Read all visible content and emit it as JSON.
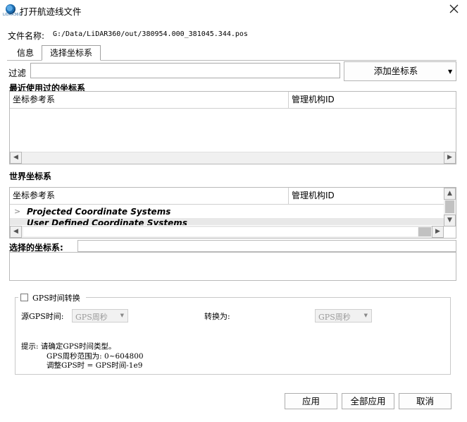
{
  "window": {
    "title": "打开航迹线文件",
    "logo_text": "LIDAR360"
  },
  "file": {
    "label": "文件名称:",
    "path": "G:/Data/LiDAR360/out/380954.000_381045.344.pos"
  },
  "tabs": [
    {
      "label": "信息",
      "active": false
    },
    {
      "label": "选择坐标系",
      "active": true
    }
  ],
  "filter": {
    "label": "过滤",
    "value": "",
    "add_button": "添加坐标系"
  },
  "recent": {
    "title": "最近使用过的坐标系",
    "columns": [
      "坐标参考系",
      "管理机构ID"
    ],
    "rows": []
  },
  "world": {
    "title": "世界坐标系",
    "columns": [
      "坐标参考系",
      "管理机构ID"
    ],
    "rows": [
      "Projected Coordinate Systems",
      "User Defined Coordinate Systems"
    ]
  },
  "selected": {
    "label": "选择的坐标系:",
    "value": ""
  },
  "gps": {
    "checkbox_label": "GPS时间转换",
    "checked": false,
    "source_label": "源GPS时间:",
    "source_value": "GPS周秒",
    "target_label": "转换为:",
    "target_value": "GPS周秒",
    "hint_line1": "提示: 请确定GPS时间类型。",
    "hint_line2": "GPS周秒范围为: 0~604800",
    "hint_line3": "调整GPS时 = GPS时间-1e9"
  },
  "buttons": {
    "apply": "应用",
    "apply_all": "全部应用",
    "cancel": "取消"
  }
}
